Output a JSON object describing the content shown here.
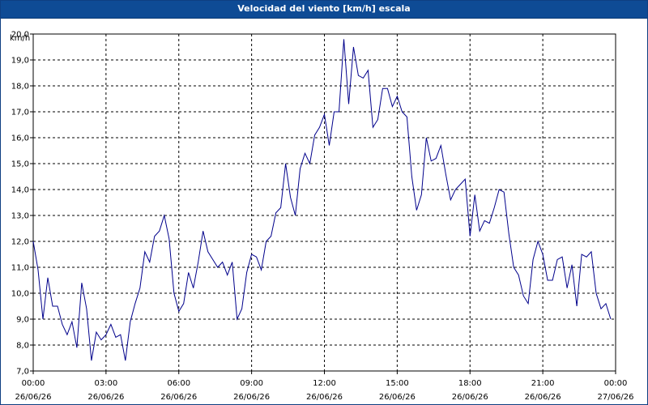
{
  "window": {
    "title": "Velocidad del viento [km/h] escala"
  },
  "chart_data": {
    "type": "line",
    "title": "Velocidad del viento [km/h] escala",
    "ylabel": "km/h",
    "xlabel": "",
    "ylim": [
      7.0,
      20.0
    ],
    "yticks": [
      "20,0",
      "19,0",
      "18,0",
      "17,0",
      "16,0",
      "15,0",
      "14,0",
      "13,0",
      "12,0",
      "11,0",
      "10,0",
      "9,0",
      "8,0",
      "7,0"
    ],
    "xticks": [
      {
        "time": "00:00",
        "date": "26/06/26"
      },
      {
        "time": "03:00",
        "date": "26/06/26"
      },
      {
        "time": "06:00",
        "date": "26/06/26"
      },
      {
        "time": "09:00",
        "date": "26/06/26"
      },
      {
        "time": "12:00",
        "date": "26/06/26"
      },
      {
        "time": "15:00",
        "date": "26/06/26"
      },
      {
        "time": "18:00",
        "date": "26/06/26"
      },
      {
        "time": "21:00",
        "date": "26/06/26"
      },
      {
        "time": "00:00",
        "date": "27/06/26"
      }
    ],
    "grid": true,
    "line_color": "#00008b",
    "series": [
      {
        "x_hours": [
          0,
          0.2,
          0.4,
          0.6,
          0.8,
          1.0,
          1.2,
          1.4,
          1.6,
          1.8,
          2.0,
          2.2,
          2.4,
          2.6,
          2.8,
          3.0,
          3.2,
          3.4,
          3.6,
          3.8,
          4.0,
          4.2,
          4.4,
          4.6,
          4.8,
          5.0,
          5.2,
          5.4,
          5.6,
          5.8,
          6.0,
          6.2,
          6.4,
          6.6,
          6.8,
          7.0,
          7.2,
          7.4,
          7.6,
          7.8,
          8.0,
          8.2,
          8.4,
          8.6,
          8.8,
          9.0,
          9.2,
          9.4,
          9.6,
          9.8,
          10.0,
          10.2,
          10.4,
          10.6,
          10.8,
          11.0,
          11.2,
          11.4,
          11.6,
          11.8,
          12.0,
          12.2,
          12.4,
          12.6,
          12.8,
          13.0,
          13.2,
          13.4,
          13.6,
          13.8,
          14.0,
          14.2,
          14.4,
          14.6,
          14.8,
          15.0,
          15.2,
          15.4,
          15.6,
          15.8,
          16.0,
          16.2,
          16.4,
          16.6,
          16.8,
          17.0,
          17.2,
          17.4,
          17.6,
          17.8,
          18.0,
          18.2,
          18.4,
          18.6,
          18.8,
          19.0,
          19.2,
          19.4,
          19.6,
          19.8,
          20.0,
          20.2,
          20.4,
          20.6,
          20.8,
          21.0,
          21.2,
          21.4,
          21.6,
          21.8,
          22.0,
          22.2,
          22.4,
          22.6,
          22.8,
          23.0,
          23.2,
          23.4,
          23.6,
          23.8
        ],
        "values": [
          12.0,
          10.9,
          9.0,
          10.6,
          9.5,
          9.5,
          8.8,
          8.4,
          8.9,
          7.9,
          10.4,
          9.4,
          7.4,
          8.5,
          8.2,
          8.4,
          8.8,
          8.3,
          8.4,
          7.4,
          8.9,
          9.6,
          10.2,
          11.6,
          11.2,
          12.2,
          12.4,
          13.0,
          12.1,
          10.0,
          9.3,
          9.6,
          10.8,
          10.2,
          11.2,
          12.4,
          11.6,
          11.3,
          11.0,
          11.2,
          10.7,
          11.2,
          9.0,
          9.4,
          10.8,
          11.5,
          11.4,
          10.9,
          12.0,
          12.2,
          13.1,
          13.3,
          15.0,
          13.7,
          13.0,
          14.8,
          15.4,
          15.0,
          16.1,
          16.4,
          16.9,
          15.7,
          17.0,
          17.0,
          19.8,
          17.3,
          19.5,
          18.4,
          18.3,
          18.6,
          16.4,
          16.7,
          17.9,
          17.9,
          17.2,
          17.6,
          17.0,
          16.8,
          14.5,
          13.2,
          13.8,
          16.0,
          15.1,
          15.2,
          15.7,
          14.6,
          13.6,
          14.0,
          14.2,
          14.4,
          12.2,
          13.8,
          12.4,
          12.8,
          12.7,
          13.3,
          14.0,
          13.9,
          12.3,
          11.0,
          10.7,
          9.9,
          9.6,
          11.3,
          12.0,
          11.5,
          10.5,
          10.5,
          11.3,
          11.4,
          10.2,
          11.1,
          9.5,
          11.5,
          11.4,
          11.6,
          10.0,
          9.4,
          9.6,
          9.0
        ]
      }
    ]
  }
}
